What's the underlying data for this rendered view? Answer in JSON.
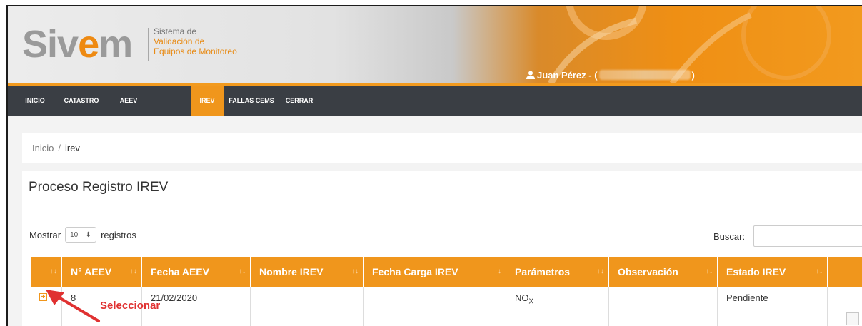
{
  "header": {
    "logo_word_1": "Siv",
    "logo_word_2": "e",
    "logo_word_3": "m",
    "subtitle_line1": "Sistema de",
    "subtitle_line2": "Validación de",
    "subtitle_line3": "Equipos de Monitoreo",
    "user_prefix": "Juan Pérez - (",
    "user_suffix": ")"
  },
  "nav": {
    "items": [
      {
        "label": "INICIO",
        "active": false
      },
      {
        "label": "CATASTRO",
        "active": false
      },
      {
        "label": "AEEV",
        "active": false
      },
      {
        "label": "IREV",
        "active": true
      },
      {
        "label": "FALLAS CEMS",
        "active": false
      },
      {
        "label": "CERRAR",
        "active": false
      }
    ]
  },
  "breadcrumb": {
    "home": "Inicio",
    "separator": "/",
    "current": "irev"
  },
  "panel": {
    "title": "Proceso Registro IREV",
    "length_prefix": "Mostrar",
    "length_value": "10",
    "length_suffix": "registros",
    "search_label": "Buscar:",
    "search_value": ""
  },
  "table": {
    "columns": [
      "",
      "N° AEEV",
      "Fecha AEEV",
      "Nombre IREV",
      "Fecha Carga IREV",
      "Parámetros",
      "Observación",
      "Estado IREV",
      ""
    ],
    "sort_glyph": "↑↓",
    "row": {
      "n_aeev": "8",
      "fecha_aeev": "21/02/2020",
      "nombre_irev": "",
      "fecha_carga": "",
      "parametros_base": "NO",
      "parametros_sub": "X",
      "observacion": "",
      "estado": "Pendiente"
    }
  },
  "annotation": {
    "label": "Seleccionar"
  },
  "colors": {
    "accent": "#f0961c",
    "nav_bg": "#3a3e44",
    "annotation": "#e03131"
  }
}
